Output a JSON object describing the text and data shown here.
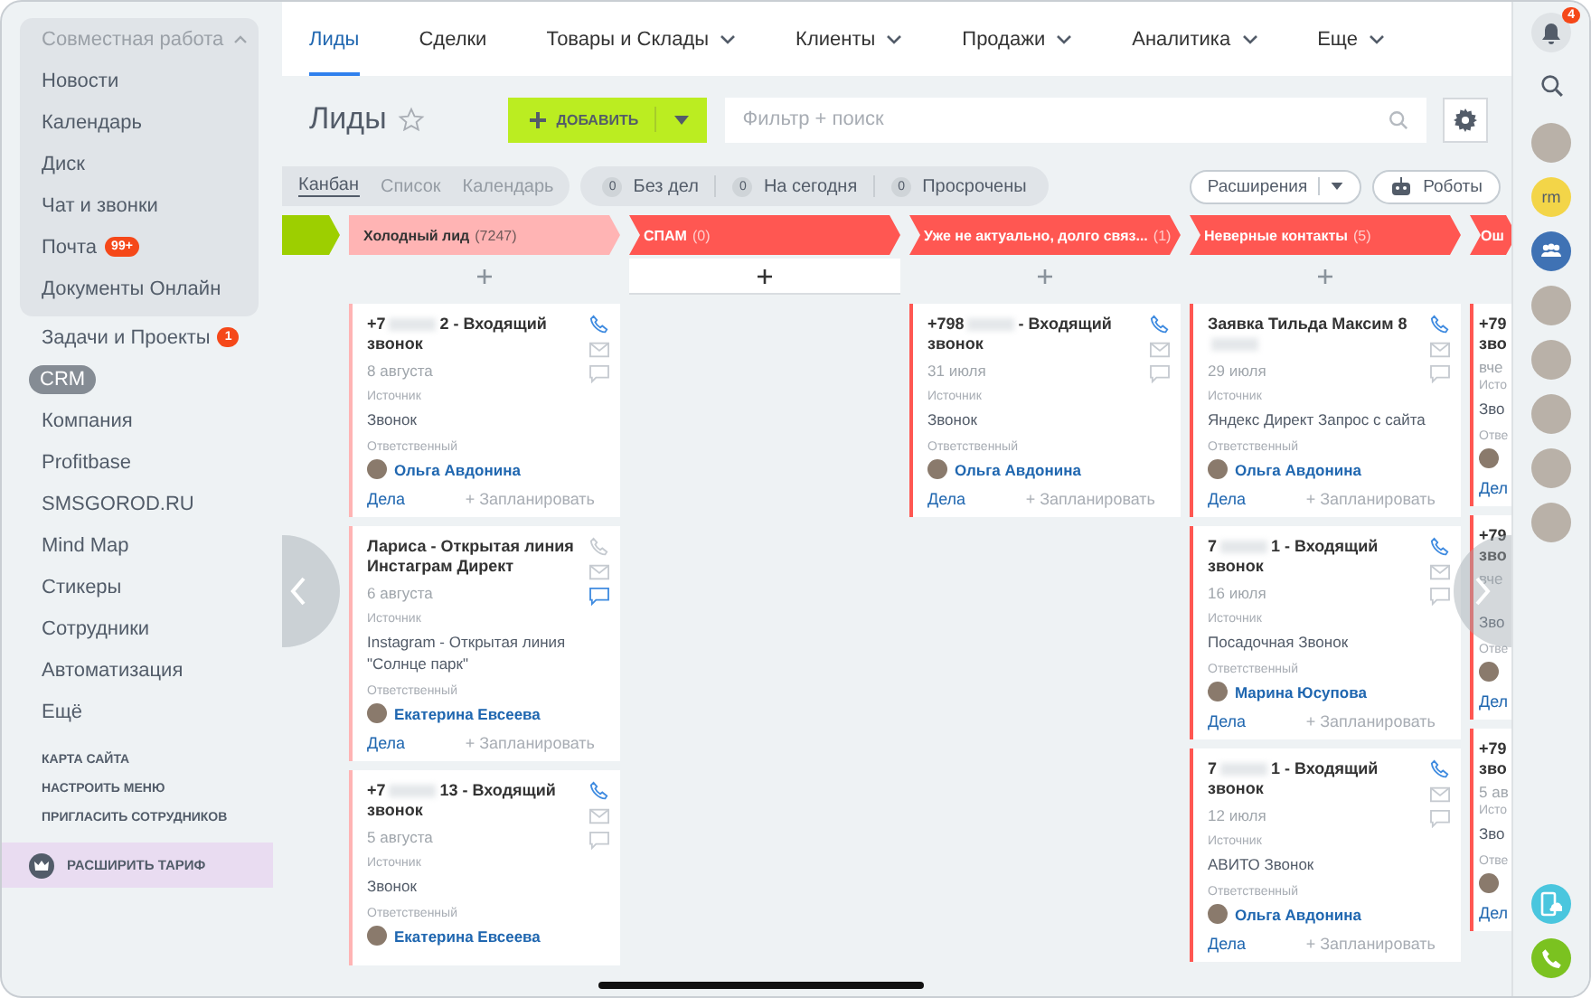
{
  "sidebar": {
    "group": {
      "title": "Совместная работа",
      "expanded": true,
      "items": [
        {
          "label": "Новости"
        },
        {
          "label": "Календарь"
        },
        {
          "label": "Диск"
        },
        {
          "label": "Чат и звонки"
        },
        {
          "label": "Почта",
          "badge": "99+"
        },
        {
          "label": "Документы Онлайн"
        }
      ]
    },
    "items": [
      {
        "label": "Задачи и Проекты",
        "badge": "1",
        "selected": false
      },
      {
        "label": "CRM",
        "selected": true
      },
      {
        "label": "Компания",
        "selected": false
      },
      {
        "label": "Profitbase",
        "selected": false
      },
      {
        "label": "SMSGOROD.RU",
        "selected": false
      },
      {
        "label": "Mind Map",
        "selected": false
      },
      {
        "label": "Стикеры",
        "selected": false
      },
      {
        "label": "Сотрудники",
        "selected": false
      },
      {
        "label": "Автоматизация",
        "selected": false
      },
      {
        "label": "Ещё",
        "selected": false
      }
    ],
    "links": [
      "КАРТА САЙТА",
      "НАСТРОИТЬ МЕНЮ",
      "ПРИГЛАСИТЬ СОТРУДНИКОВ"
    ],
    "upgrade": "РАСШИРИТЬ ТАРИФ"
  },
  "tabs": [
    {
      "label": "Лиды",
      "selected": true,
      "menu": false
    },
    {
      "label": "Сделки",
      "selected": false,
      "menu": false
    },
    {
      "label": "Товары и Склады",
      "selected": false,
      "menu": true
    },
    {
      "label": "Клиенты",
      "selected": false,
      "menu": true
    },
    {
      "label": "Продажи",
      "selected": false,
      "menu": true
    },
    {
      "label": "Аналитика",
      "selected": false,
      "menu": true
    },
    {
      "label": "Еще",
      "selected": false,
      "menu": true
    }
  ],
  "toolbar": {
    "title": "Лиды",
    "add_button": "ДОБАВИТЬ",
    "search": {
      "placeholder": "Фильтр + поиск"
    }
  },
  "views": [
    {
      "label": "Канбан",
      "selected": true
    },
    {
      "label": "Список",
      "selected": false
    },
    {
      "label": "Календарь",
      "selected": false
    }
  ],
  "counters": [
    {
      "count": "0",
      "label": "Без дел"
    },
    {
      "count": "0",
      "label": "На сегодня"
    },
    {
      "count": "0",
      "label": "Просрочены"
    }
  ],
  "extensions_button": "Расширения",
  "robots_button": "Роботы",
  "columns": [
    {
      "kind": "stub",
      "color": "#9dcf00"
    },
    {
      "kind": "full",
      "name": "Холодный лид",
      "count": "(7247)",
      "color": "#ffb4b4",
      "plus_selected": false,
      "cards": [
        {
          "kind": "lead",
          "title": "+7",
          "blurred": true,
          "title_after": "2 - Входящий звонок",
          "date": "8 августа",
          "source_label": "Источник",
          "source": "Звонок",
          "owner_label": "Ответственный",
          "owner": "Ольга Авдонина",
          "phone_active": true,
          "chat_active": false,
          "footer": {
            "tasks": "Дела",
            "plan": "+ Запланировать"
          }
        },
        {
          "kind": "lead",
          "title": "Лариса - Открытая линия Инстаграм Директ",
          "blurred": false,
          "date": "6 августа",
          "source_label": "Источник",
          "source": "Instagram - Открытая линия \"Солнце парк\"",
          "owner_label": "Ответственный",
          "owner": "Екатерина Евсеева",
          "phone_active": false,
          "chat_active": true,
          "footer": {
            "tasks": "Дела",
            "plan": "+ Запланировать"
          }
        },
        {
          "kind": "lead",
          "title": "+7",
          "blurred": true,
          "title_after": "13 - Входящий звонок",
          "date": "5 августа",
          "source_label": "Источник",
          "source": "Звонок",
          "owner_label": "Ответственный",
          "owner": "Екатерина Евсеева",
          "phone_active": true,
          "chat_active": false
        }
      ]
    },
    {
      "kind": "full",
      "name": "СПАМ",
      "count": "(0)",
      "color": "#ff5752",
      "plus_selected": true
    },
    {
      "kind": "full",
      "name": "Уже не актуально, долго связ...",
      "count": "(1)",
      "color": "#ff5752",
      "plus_selected": false,
      "cards": [
        {
          "kind": "lead",
          "title": "+798",
          "blurred": true,
          "title_after": "- Входящий звонок",
          "date": "31 июля",
          "source_label": "Источник",
          "source": "Звонок",
          "owner_label": "Ответственный",
          "owner": "Ольга Авдонина",
          "phone_active": true,
          "chat_active": false,
          "footer": {
            "tasks": "Дела",
            "plan": "+ Запланировать"
          }
        }
      ]
    },
    {
      "kind": "full",
      "name": "Неверные контакты",
      "count": "(5)",
      "color": "#ff5752",
      "plus_selected": false,
      "cards": [
        {
          "kind": "lead",
          "title": "Заявка Тильда Максим 8",
          "blurred": true,
          "date": "29 июля",
          "source_label": "Источник",
          "source": "Яндекс Директ Запрос с сайта",
          "owner_label": "Ответственный",
          "owner": "Ольга Авдонина",
          "phone_active": true,
          "chat_active": false,
          "footer": {
            "tasks": "Дела",
            "plan": "+ Запланировать"
          }
        },
        {
          "kind": "lead",
          "title": "7",
          "blurred": true,
          "title_after": "1 - Входящий звонок",
          "date": "16 июля",
          "source_label": "Источник",
          "source": "Посадочная Звонок",
          "owner_label": "Ответственный",
          "owner": "Марина Юсупова",
          "phone_active": true,
          "chat_active": false,
          "footer": {
            "tasks": "Дела",
            "plan": "+ Запланировать"
          }
        },
        {
          "kind": "lead",
          "title": "7",
          "blurred": true,
          "title_after": "1 - Входящий звонок",
          "date": "12 июля",
          "source_label": "Источник",
          "source": "АВИТО Звонок",
          "owner_label": "Ответственный",
          "owner": "Ольга Авдонина",
          "phone_active": true,
          "chat_active": false,
          "footer": {
            "tasks": "Дела",
            "plan": "+ Запланировать"
          }
        }
      ]
    },
    {
      "kind": "partial",
      "name": "Ош",
      "color": "#ff5752",
      "cards": [
        {
          "kind": "partial",
          "title": "+79",
          "title2": "зво",
          "date": "вче",
          "source_label": "Исто",
          "source": "Зво",
          "owner_label": "Отве",
          "tasks": "Дел"
        },
        {
          "kind": "partial",
          "title": "+79",
          "title2": "зво",
          "date": "вче",
          "source": "Зво",
          "owner_label": "Отве",
          "tasks": "Дел"
        },
        {
          "kind": "partial",
          "title": "+79",
          "title2": "зво",
          "date": "5 ав",
          "source_label": "Исто",
          "source": "Зво",
          "owner_label": "Отве",
          "tasks": "Дел"
        }
      ]
    }
  ],
  "right_rail": {
    "notifications": "4",
    "contacts": [
      {
        "kind": "photo"
      },
      {
        "kind": "initials",
        "text": "rm"
      },
      {
        "kind": "group"
      },
      {
        "kind": "photo"
      },
      {
        "kind": "photo"
      },
      {
        "kind": "photo"
      },
      {
        "kind": "photo"
      },
      {
        "kind": "photo"
      }
    ]
  }
}
